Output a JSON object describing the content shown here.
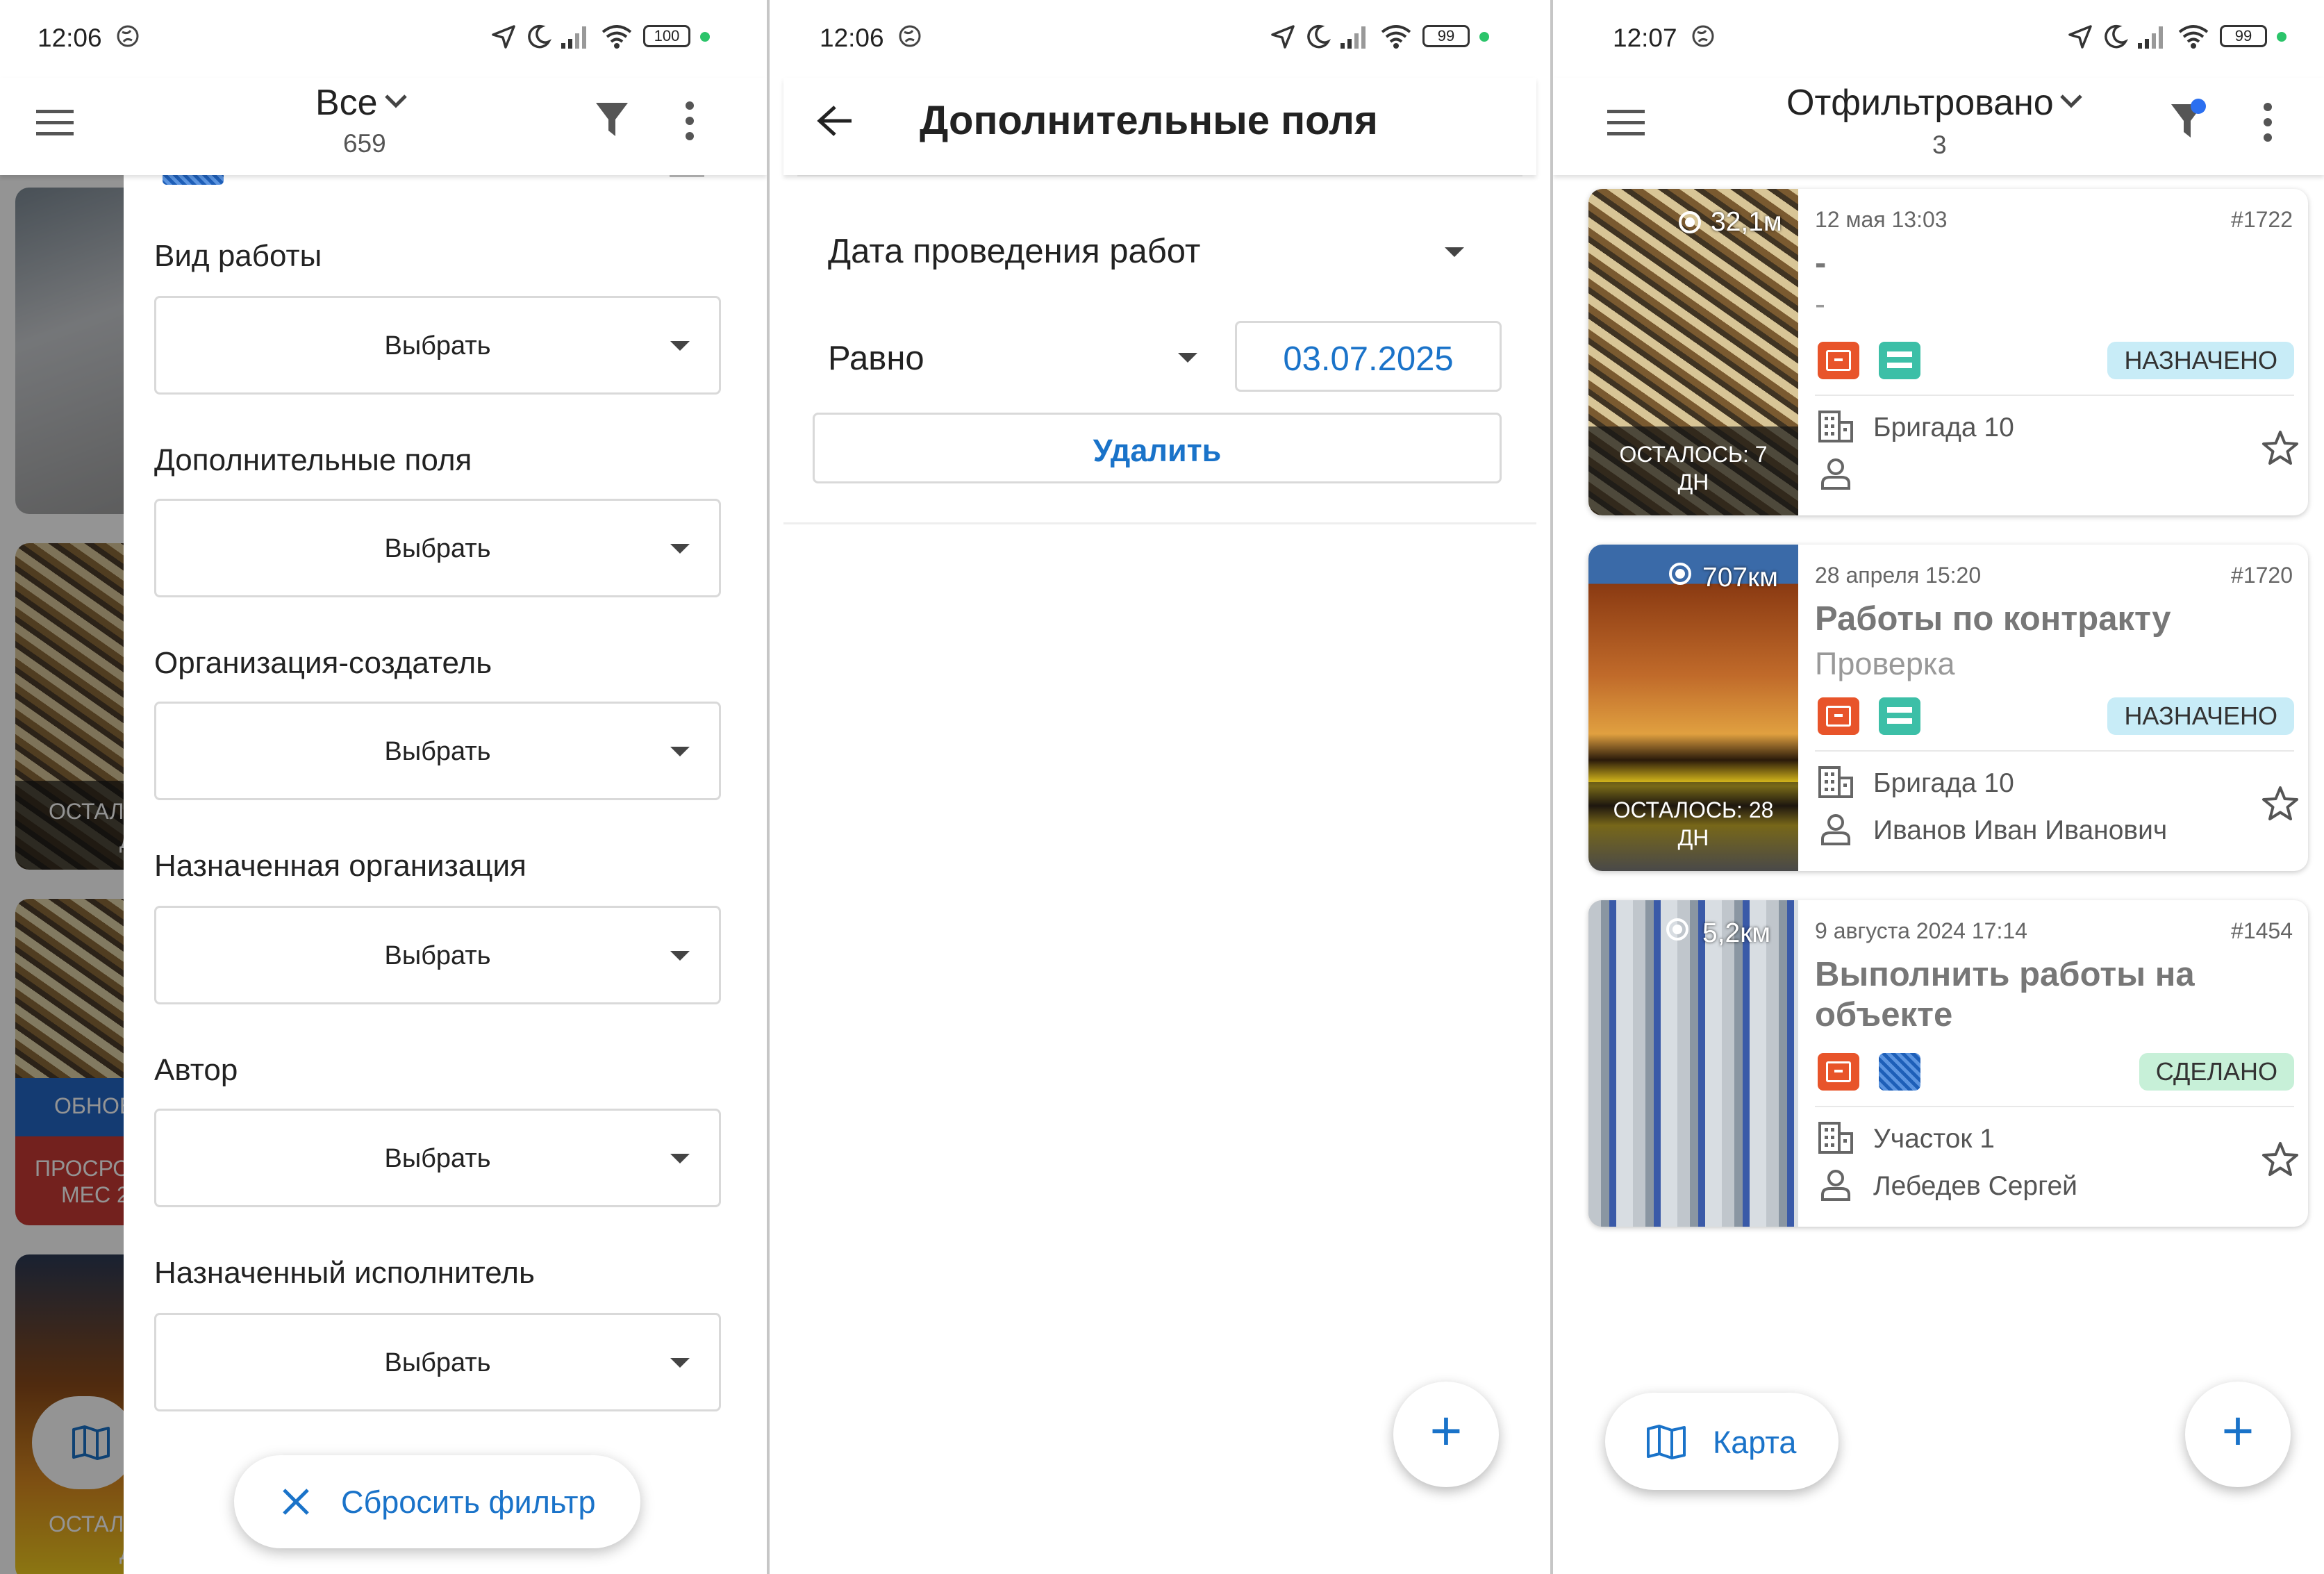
{
  "screen1": {
    "status": {
      "time": "12:06",
      "battery": "100"
    },
    "header": {
      "title": "Все",
      "count": "659"
    },
    "bg_cards": {
      "left1": "ОСТАЛ",
      "left1b": "Д",
      "obnov": "ОБНОВ",
      "prosr": "ПРОСРО",
      "mes": "МЕС 2",
      "left2": "ОСТАЛО",
      "left2b": "Д"
    },
    "filters": [
      {
        "label": "Вид работы",
        "value": "Выбрать"
      },
      {
        "label": "Дополнительные поля",
        "value": "Выбрать"
      },
      {
        "label": "Организация-создатель",
        "value": "Выбрать"
      },
      {
        "label": "Назначенная организация",
        "value": "Выбрать"
      },
      {
        "label": "Автор",
        "value": "Выбрать"
      },
      {
        "label": "Назначенный исполнитель",
        "value": "Выбрать"
      }
    ],
    "reset_label": "Сбросить фильтр"
  },
  "screen2": {
    "status": {
      "time": "12:06",
      "battery": "99"
    },
    "title": "Дополнительные поля",
    "field_select": "Дата проведения работ",
    "operator": "Равно",
    "date_value": "03.07.2025",
    "delete_label": "Удалить",
    "fab_label": "+"
  },
  "screen3": {
    "status": {
      "time": "12:07",
      "battery": "99"
    },
    "header": {
      "title": "Отфильтровано",
      "count": "3"
    },
    "cards": [
      {
        "distance": "32,1м",
        "remaining": "ОСТАЛОСЬ: 7 ДН",
        "date": "12 мая 13:03",
        "number": "#1722",
        "title": "-",
        "subtitle": "-",
        "status": "НАЗНАЧЕНО",
        "org": "Бригада 10",
        "person": ""
      },
      {
        "distance": "707км",
        "remaining": "ОСТАЛОСЬ: 28 ДН",
        "date": "28 апреля 15:20",
        "number": "#1720",
        "title": "Работы по контракту",
        "subtitle": "Проверка",
        "status": "НАЗНАЧЕНО",
        "org": "Бригада 10",
        "person": "Иванов Иван Иванович"
      },
      {
        "distance": "5,2км",
        "remaining": "",
        "date": "9 августа 2024 17:14",
        "number": "#1454",
        "title": "Выполнить работы на объекте",
        "subtitle": "",
        "status": "СДЕЛАНО",
        "org": "Участок 1",
        "person": "Лебедев Сергей"
      }
    ],
    "map_label": "Карта",
    "fab_label": "+"
  },
  "colors": {
    "accent": "#1a73c9",
    "assigned_bg": "#c8ecf7",
    "done_bg": "#c7f0d8",
    "type_orange": "#e8542a",
    "type_teal": "#3cbfa7",
    "filter_dot": "#2b6ff0"
  },
  "icons": [
    "menu-icon",
    "chevron-down-icon",
    "filter-icon",
    "more-vert-icon",
    "back-arrow-icon",
    "close-icon",
    "map-icon",
    "add-icon",
    "building-icon",
    "person-icon",
    "star-outline-icon",
    "location-arrow-icon",
    "moon-icon",
    "signal-icon",
    "wifi-icon",
    "battery-icon",
    "target-icon"
  ]
}
